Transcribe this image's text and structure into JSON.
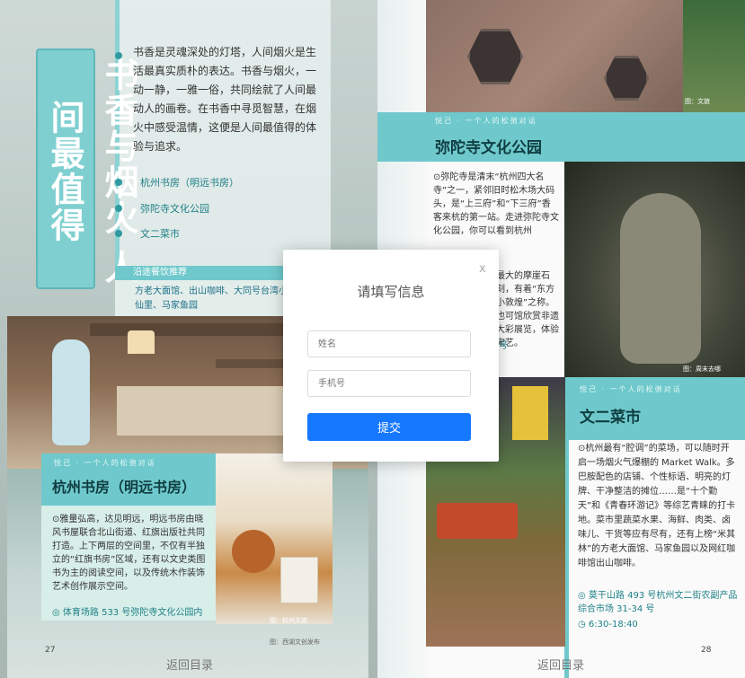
{
  "left_page": {
    "vertical_title": "书香与烟火 人间最值得",
    "intro": "书香是灵魂深处的灯塔，人间烟火是生活最真实质朴的表达。书香与烟火，一动一静，一雅一俗，共同绘就了人间最动人的画卷。在书香中寻觅智慧，在烟火中感受温情，这便是人间最值得的体验与追求。",
    "toc": [
      "杭州书房（明远书房）",
      "弥陀寺文化公园",
      "文二菜市"
    ],
    "recommend_heading": "沿途餐饮推荐",
    "recommend_text": "方老大面馆、出山咖啡、大同号台湾小生仙里、马家鱼园",
    "card": {
      "eyebrow": "悦己 · 一个人的松弛对话",
      "title": "杭州书房（明远书房）",
      "body": "⊙雅量弘高，达见明远，明远书房由晓风书屋联合北山街道、红旗出版社共同打造。上下两层的空间里，不仅有半独立的“红旗书房”区域，还有以文史类图书为主的阅读空间，以及传统木作装饰艺术创作展示空间。",
      "address": "体育场路 533 号弥陀寺文化公园内"
    },
    "photo_credits": [
      "图：杭州文旅",
      "图：西湖文创发布"
    ],
    "back_label": "返回目录",
    "page_number": "27"
  },
  "right_page": {
    "top_credit": "图：文旅",
    "section1": {
      "eyebrow": "悦己 · 一个人的松弛对话",
      "title": "弥陀寺文化公园",
      "body": "⊙弥陀寺是清末“杭州四大名寺”之一，紧邻旧时松木场大码头，是“上三府”和“下三府”香客来杭的第一站。走进弥陀寺文化公园，你可以看到杭州",
      "body_right": "最大的摩崖石刻，有着“东方小敦煌”之称。也可馆欣赏非遗大彩展览，体验宋艺。",
      "address_tail": "号",
      "credit": "图：周末去哪"
    },
    "section2": {
      "eyebrow": "悦己 · 一个人的松弛对话",
      "title": "文二菜市",
      "body": "⊙杭州最有“腔调”的菜场，可以随时开启一场烟火气爆棚的 Market Walk。多巴胺配色的店铺、个性标语、明亮的灯牌、干净整洁的摊位……是“十个勤天”和《青春环游记》等综艺青睐的打卡地。菜市里蔬菜水果、海鲜、肉类、卤味儿、干货等应有尽有，还有上榜“米其林”的方老大面馆、马家鱼园以及网红咖啡馆出山咖啡。",
      "address": "莫干山路 493 号杭州文二街农副产品综合市场 31-34 号",
      "hours": "6:30-18:40"
    },
    "back_label": "返回目录",
    "page_number": "28"
  },
  "modal": {
    "title": "请填写信息",
    "close": "x",
    "name_placeholder": "姓名",
    "phone_placeholder": "手机号",
    "submit_label": "提交"
  },
  "colors": {
    "accent_teal": "#6fc9cc",
    "submit_blue": "#1677ff"
  },
  "icons": [
    "location-icon",
    "clock-icon",
    "close-icon"
  ]
}
